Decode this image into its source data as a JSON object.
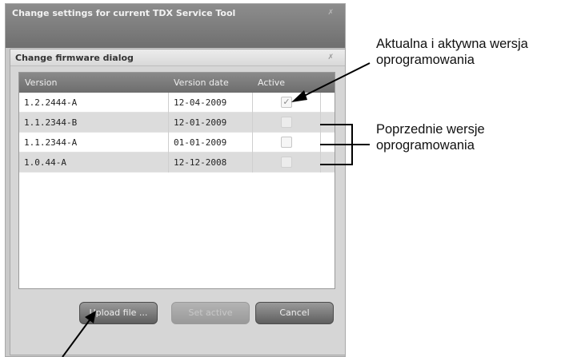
{
  "outer_window": {
    "title": "Change settings for current TDX Service Tool",
    "close_glyph": "✗"
  },
  "dialog": {
    "title": "Change firmware dialog",
    "close_glyph": "✗"
  },
  "table": {
    "columns": [
      "Version",
      "Version date",
      "Active"
    ],
    "rows": [
      {
        "version": "1.2.2444-A",
        "date": "12-04-2009",
        "active": true,
        "check_glyph": "✓"
      },
      {
        "version": "1.1.2344-B",
        "date": "12-01-2009",
        "active": false,
        "check_glyph": ""
      },
      {
        "version": "1.1.2344-A",
        "date": "01-01-2009",
        "active": false,
        "check_glyph": ""
      },
      {
        "version": "1.0.44-A",
        "date": "12-12-2008",
        "active": false,
        "check_glyph": ""
      }
    ]
  },
  "buttons": {
    "upload": "Upload file ...",
    "set_active": "Set active",
    "cancel": "Cancel"
  },
  "annotations": {
    "active_line1": "Aktualna i aktywna wersja",
    "active_line2": "oprogramowania",
    "previous_line1": "Poprzednie wersje",
    "previous_line2": "oprogramowania"
  }
}
